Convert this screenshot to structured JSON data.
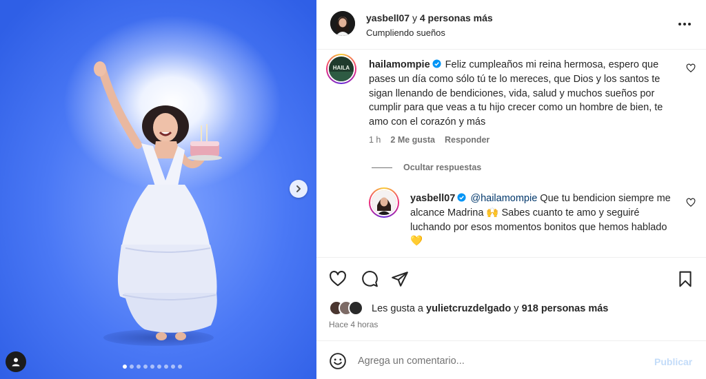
{
  "post": {
    "author": "yasbell07",
    "author_joiner": " y ",
    "coauthors": "4 personas más",
    "subtitle": "Cumpliendo sueños",
    "carousel": {
      "total_slides": 9,
      "active_index": 0
    }
  },
  "comments": [
    {
      "username": "hailamompie",
      "avatar_text": "HAILA",
      "verified": true,
      "text": "Feliz cumpleaños mi reina hermosa, espero que pases un día como sólo tú te lo mereces, que Dios y los santos te sigan llenando de bendiciones, vida, salud y muchos sueños por cumplir para que veas a tu hijo crecer como un hombre de bien, te amo con el corazón y más",
      "time": "1 h",
      "likes": "2 Me gusta",
      "reply_label": "Responder",
      "hide_replies": "Ocultar respuestas",
      "replies": [
        {
          "username": "yasbell07",
          "verified": true,
          "mention": "@hailamompie",
          "text": " Que tu bendicion siempre me alcance Madrina 🙌 Sabes cuanto te amo y seguiré luchando por esos momentos bonitos que hemos hablado 💛"
        }
      ]
    }
  ],
  "likes": {
    "prefix": "Les gusta a ",
    "user": "yulietcruzdelgado",
    "joiner": " y ",
    "others": "918 personas más"
  },
  "time_ago": "Hace 4 horas",
  "composer": {
    "placeholder": "Agrega un comentario...",
    "publish_label": "Publicar"
  },
  "icons": {
    "like": "heart-icon",
    "comment": "comment-bubble-icon",
    "share": "paper-plane-icon",
    "save": "bookmark-icon",
    "emoji": "smiley-icon",
    "more": "more-options-icon",
    "next": "chevron-right-icon",
    "tag": "user-tag-icon"
  },
  "colors": {
    "link": "#00376b",
    "muted": "#737373",
    "publish_disabled": "#c3dcf9",
    "verified": "#0095f6"
  }
}
